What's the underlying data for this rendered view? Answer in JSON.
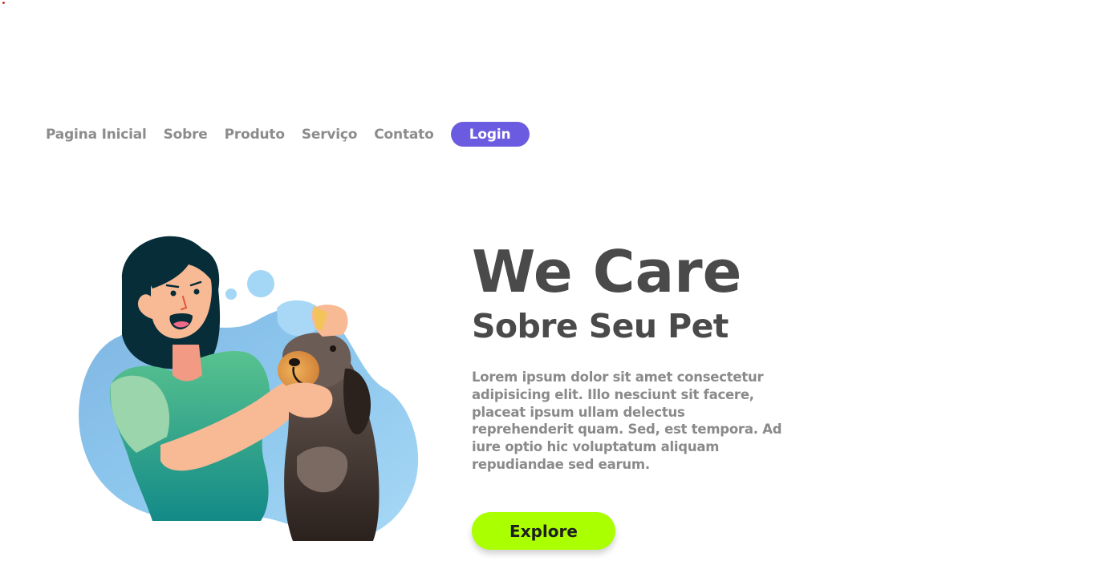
{
  "nav": {
    "items": [
      {
        "label": "Pagina Inicial"
      },
      {
        "label": "Sobre"
      },
      {
        "label": "Produto"
      },
      {
        "label": "Serviço"
      },
      {
        "label": "Contato"
      }
    ],
    "login_label": "Login"
  },
  "hero": {
    "title": "We Care",
    "subtitle": "Sobre Seu Pet",
    "description": "Lorem ipsum dolor sit amet consectetur adipisicing elit. Illo nesciunt sit facere, placeat ipsum ullam delectus reprehenderit quam. Sed, est tempora. Ad iure optio hic voluptatum aliquam repudiandae sed earum.",
    "cta_label": "Explore"
  },
  "colors": {
    "accent_purple": "#6b5be0",
    "cta_green": "#aaff00",
    "heading": "#4a4a4a",
    "muted_text": "#8a8a8a"
  },
  "illustration": {
    "icon": "woman-grooming-dog-illustration"
  }
}
